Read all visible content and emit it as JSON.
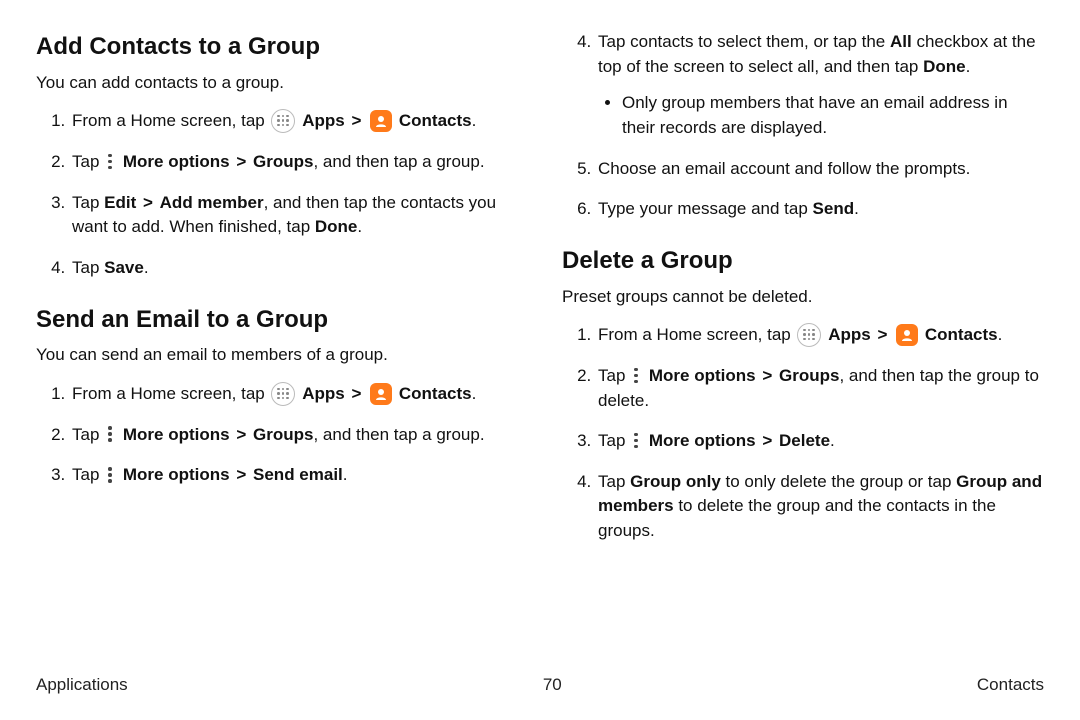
{
  "common": {
    "from_home": "From a Home screen, tap",
    "apps": "Apps",
    "contacts": "Contacts",
    "chev": ">",
    "tap": "Tap",
    "more_options": "More options",
    "groups": "Groups",
    "comma_then_tap_group": ", and then tap a group.",
    "period": "."
  },
  "s1": {
    "title": "Add Contacts to a Group",
    "intro": "You can add contacts to a group."
  },
  "s1step3": {
    "a": "Tap ",
    "edit": "Edit",
    "add_member": "Add member",
    "b": ", and then tap the contacts you want to add. When finished, tap ",
    "done": "Done"
  },
  "s1step4": {
    "a": "Tap ",
    "save": "Save"
  },
  "s2": {
    "title": "Send an Email to a Group",
    "intro": "You can send an email to members of a group.",
    "send_email": "Send email"
  },
  "s2step4": {
    "a": "Tap contacts to select them, or tap the ",
    "all": "All",
    "b": " checkbox at the top of the screen to select all, and then tap ",
    "done": "Done",
    "sub": "Only group members that have an email address in their records are displayed."
  },
  "s2step5": "Choose an email account and follow the prompts.",
  "s2step6": {
    "a": "Type your message and tap ",
    "send": "Send"
  },
  "s3": {
    "title": "Delete a Group",
    "intro": "Preset groups cannot be deleted.",
    "then_tap_group_to_delete": ", and then tap the group to delete.",
    "delete": "Delete"
  },
  "s3step4": {
    "a": "Tap ",
    "group_only": "Group only",
    "b": " to only delete the group or tap ",
    "group_and_members": "Group and members",
    "c": " to delete the group and the contacts in the groups."
  },
  "footer": {
    "left": "Applications",
    "page": "70",
    "right": "Contacts"
  }
}
